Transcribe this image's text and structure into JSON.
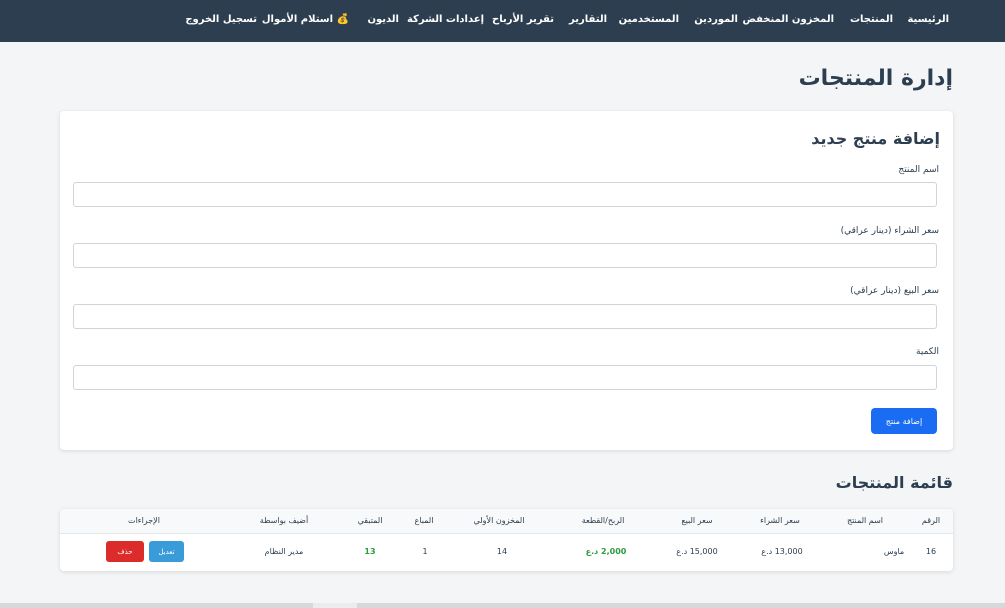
{
  "nav": {
    "items": [
      {
        "label": "الرئيسية"
      },
      {
        "label": "المنتجات"
      },
      {
        "label": "المخزون المنخفض"
      },
      {
        "label": "الموردين"
      },
      {
        "label": "المستخدمين"
      },
      {
        "label": "التقارير"
      },
      {
        "label": "تقرير الأرباح"
      },
      {
        "label": "إعدادات الشركة"
      },
      {
        "label": "الديون"
      },
      {
        "label": "💰 استلام الأموال"
      },
      {
        "label": "تسجيل الخروج"
      }
    ]
  },
  "page": {
    "title": "إدارة المنتجات"
  },
  "form": {
    "title": "إضافة منتج جديد",
    "fields": [
      {
        "label": "اسم المنتج",
        "value": ""
      },
      {
        "label": "سعر الشراء (دينار عراقي)",
        "value": ""
      },
      {
        "label": "سعر البيع (دينار عراقي)",
        "value": ""
      },
      {
        "label": "الكمية",
        "value": ""
      }
    ],
    "submit_label": "إضافة منتج"
  },
  "list": {
    "title": "قائمة المنتجات",
    "columns": [
      "الرقم",
      "اسم المنتج",
      "سعر الشراء",
      "سعر البيع",
      "الربح/القطعة",
      "المخزون الأولي",
      "المباع",
      "المتبقي",
      "أضيف بواسطة",
      "الإجراءات"
    ],
    "rows": [
      {
        "id": "16",
        "name": "ماوس",
        "purchase_price": "13,000 د.ع",
        "sale_price": "15,000 د.ع",
        "profit": "2,000 د.ع",
        "initial_stock": "14",
        "sold": "1",
        "remaining": "13",
        "added_by": "مدير النظام",
        "edit_label": "تعديل",
        "delete_label": "حذف"
      }
    ]
  }
}
